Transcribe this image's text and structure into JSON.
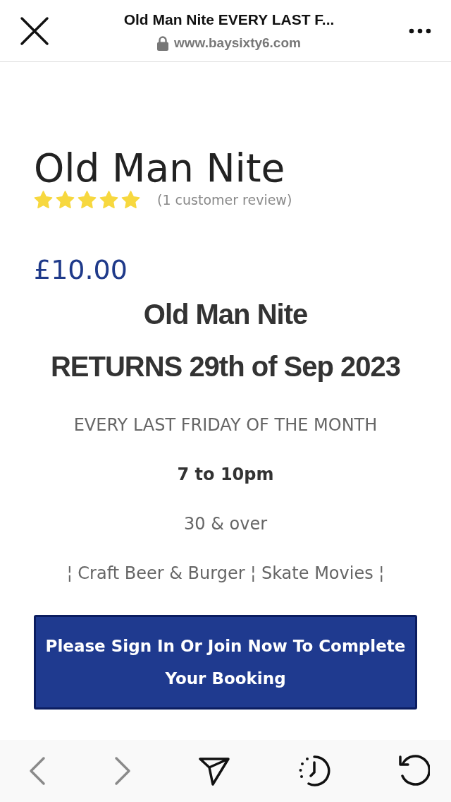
{
  "browser_bar": {
    "title": "Old Man Nite EVERY LAST F...",
    "url": "www.baysixty6.com"
  },
  "product": {
    "title": "Old Man Nite",
    "stars": 5,
    "review_count": "(1 customer review)",
    "price": "£10.00"
  },
  "description": [
    {
      "kind": "heading",
      "text": "Old Man Nite"
    },
    {
      "kind": "heading",
      "text": "RETURNS 29th of Sep 2023"
    },
    {
      "kind": "plain",
      "text": "EVERY LAST FRIDAY OF THE MONTH"
    },
    {
      "kind": "bold",
      "text": "7 to 10pm"
    },
    {
      "kind": "plain",
      "text": "30 & over"
    },
    {
      "kind": "plain",
      "text": "¦ Craft Beer & Burger ¦ Skate Movies ¦"
    }
  ],
  "booking_button": "Please Sign In Or Join Now To Complete Your Booking",
  "toolbar": {
    "back": {
      "disabled": true
    },
    "forward": {
      "disabled": true
    }
  }
}
